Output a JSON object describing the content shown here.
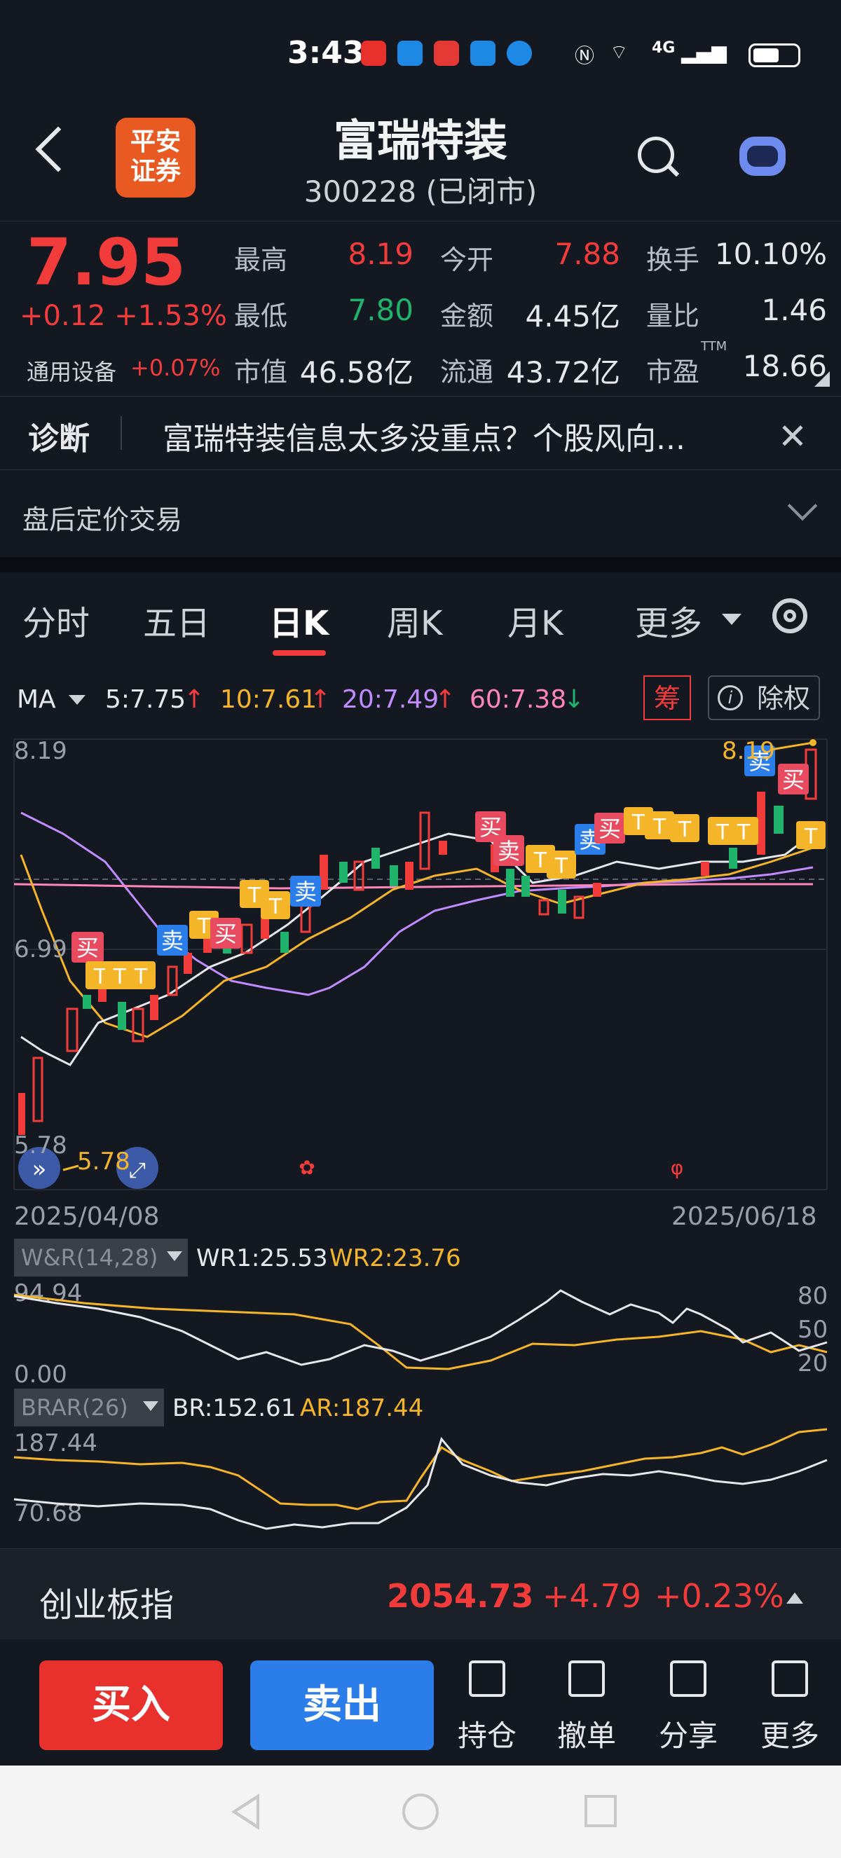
{
  "status": {
    "time": "3:43",
    "network": "4G",
    "app_icon_colors": [
      "#e8302c",
      "#1e88e5",
      "#e53935",
      "#1e88e5",
      "#1e88e5"
    ]
  },
  "header": {
    "logo_line1": "平安",
    "logo_line2": "证券",
    "stock_name": "富瑞特装",
    "stock_code_status": "300228 (已闭市)"
  },
  "quote": {
    "price": "7.95",
    "change": "+0.12 +1.53%",
    "industry": "通用设备",
    "industry_pct": "+0.07%",
    "fields": [
      {
        "label": "最高",
        "value": "8.19",
        "color": "red"
      },
      {
        "label": "今开",
        "value": "7.88",
        "color": "red"
      },
      {
        "label": "换手",
        "value": "10.10%",
        "color": "white"
      },
      {
        "label": "最低",
        "value": "7.80",
        "color": "green"
      },
      {
        "label": "金额",
        "value": "4.45亿",
        "color": "white"
      },
      {
        "label": "量比",
        "value": "1.46",
        "color": "white"
      },
      {
        "label": "市值",
        "value": "46.58亿",
        "color": "white"
      },
      {
        "label": "流通",
        "value": "43.72亿",
        "color": "white"
      },
      {
        "label": "市盈",
        "value": "18.66",
        "color": "white"
      }
    ],
    "ttm": "TTM"
  },
  "diagnose": {
    "tag": "诊断",
    "text": "富瑞特装信息太多没重点？个股风向..."
  },
  "after_hours": {
    "label": "盘后定价交易"
  },
  "tabs": [
    {
      "label": "分时"
    },
    {
      "label": "五日"
    },
    {
      "label": "日K",
      "active": true
    },
    {
      "label": "周K"
    },
    {
      "label": "月K"
    },
    {
      "label": "更多"
    }
  ],
  "ma": {
    "label": "MA",
    "ma5": "5:7.75",
    "ma10": "10:7.61",
    "ma20": "20:7.49",
    "ma60": "60:7.38",
    "chou": "筹",
    "chuquan": "除权"
  },
  "kchart": {
    "y_top": "8.19",
    "y_mid": "6.99",
    "y_bot": "5.78",
    "high_mark": "8.19",
    "low_mark": "5.78",
    "date_start": "2025/04/08",
    "date_end": "2025/06/18",
    "marker_buy": "买",
    "marker_sell": "卖",
    "marker_t": "T"
  },
  "wr": {
    "tag": "W&R(14,28)",
    "wr1": "WR1:25.53",
    "wr2": "WR2:23.76",
    "y_top": "94.94",
    "y_bot": "0.00",
    "r80": "80",
    "r50": "50",
    "r20": "20"
  },
  "brar": {
    "tag": "BRAR(26)",
    "br": "BR:152.61",
    "ar": "AR:187.44",
    "y_top": "187.44",
    "y_bot": "70.68"
  },
  "index": {
    "name": "创业板指",
    "value": "2054.73",
    "change": "+4.79",
    "pct": "+0.23%"
  },
  "trade": {
    "buy": "买入",
    "sell": "卖出",
    "tools": [
      "持仓",
      "撤单",
      "分享",
      "更多"
    ]
  }
}
